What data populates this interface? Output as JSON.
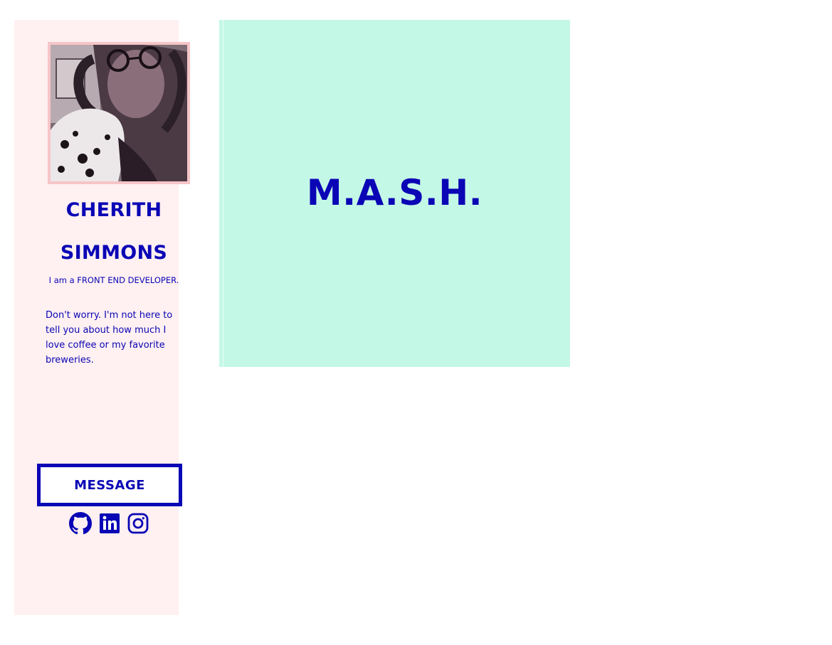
{
  "profile": {
    "first_name": "CHERITH",
    "last_name": "SIMMONS",
    "tagline": "I am a FRONT END DEVELOPER.",
    "bio": "Don't worry. I'm not here to tell you about how much I love coffee or my favorite breweries.",
    "photo_icon": "profile-photo"
  },
  "actions": {
    "message_label": "MESSAGE"
  },
  "social": [
    {
      "icon": "github-icon"
    },
    {
      "icon": "linkedin-icon"
    },
    {
      "icon": "instagram-icon"
    }
  ],
  "projects": [
    {
      "title": "M.A.S.H."
    }
  ],
  "colors": {
    "accent": "#0a05b5",
    "sidebar_bg": "#fff0f1",
    "card_bg": "#c4f8e6",
    "avatar_border": "#f6c5c8"
  }
}
